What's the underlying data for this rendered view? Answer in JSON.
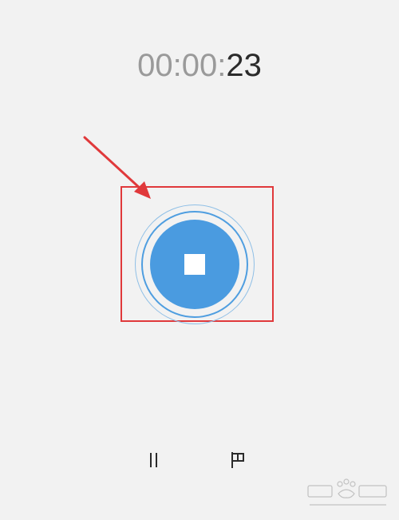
{
  "timer": {
    "hours_minutes": "00:00:",
    "seconds": "23"
  },
  "controls": {
    "stop_icon": "stop-icon",
    "pause_icon": "pause-icon",
    "flag_icon": "flag-icon"
  },
  "annotation": {
    "color": "#e0393b"
  },
  "colors": {
    "accent": "#4a9be0",
    "background": "#f2f2f2"
  }
}
